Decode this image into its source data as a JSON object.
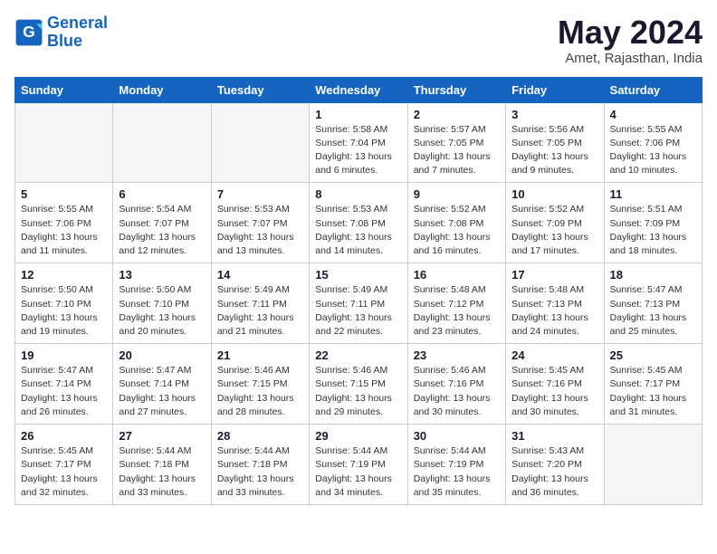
{
  "logo": {
    "line1": "General",
    "line2": "Blue"
  },
  "title": "May 2024",
  "location": "Amet, Rajasthan, India",
  "days_of_week": [
    "Sunday",
    "Monday",
    "Tuesday",
    "Wednesday",
    "Thursday",
    "Friday",
    "Saturday"
  ],
  "weeks": [
    [
      {
        "num": "",
        "info": "",
        "empty": true
      },
      {
        "num": "",
        "info": "",
        "empty": true
      },
      {
        "num": "",
        "info": "",
        "empty": true
      },
      {
        "num": "1",
        "info": "Sunrise: 5:58 AM\nSunset: 7:04 PM\nDaylight: 13 hours\nand 6 minutes."
      },
      {
        "num": "2",
        "info": "Sunrise: 5:57 AM\nSunset: 7:05 PM\nDaylight: 13 hours\nand 7 minutes."
      },
      {
        "num": "3",
        "info": "Sunrise: 5:56 AM\nSunset: 7:05 PM\nDaylight: 13 hours\nand 9 minutes."
      },
      {
        "num": "4",
        "info": "Sunrise: 5:55 AM\nSunset: 7:06 PM\nDaylight: 13 hours\nand 10 minutes."
      }
    ],
    [
      {
        "num": "5",
        "info": "Sunrise: 5:55 AM\nSunset: 7:06 PM\nDaylight: 13 hours\nand 11 minutes."
      },
      {
        "num": "6",
        "info": "Sunrise: 5:54 AM\nSunset: 7:07 PM\nDaylight: 13 hours\nand 12 minutes."
      },
      {
        "num": "7",
        "info": "Sunrise: 5:53 AM\nSunset: 7:07 PM\nDaylight: 13 hours\nand 13 minutes."
      },
      {
        "num": "8",
        "info": "Sunrise: 5:53 AM\nSunset: 7:08 PM\nDaylight: 13 hours\nand 14 minutes."
      },
      {
        "num": "9",
        "info": "Sunrise: 5:52 AM\nSunset: 7:08 PM\nDaylight: 13 hours\nand 16 minutes."
      },
      {
        "num": "10",
        "info": "Sunrise: 5:52 AM\nSunset: 7:09 PM\nDaylight: 13 hours\nand 17 minutes."
      },
      {
        "num": "11",
        "info": "Sunrise: 5:51 AM\nSunset: 7:09 PM\nDaylight: 13 hours\nand 18 minutes."
      }
    ],
    [
      {
        "num": "12",
        "info": "Sunrise: 5:50 AM\nSunset: 7:10 PM\nDaylight: 13 hours\nand 19 minutes."
      },
      {
        "num": "13",
        "info": "Sunrise: 5:50 AM\nSunset: 7:10 PM\nDaylight: 13 hours\nand 20 minutes."
      },
      {
        "num": "14",
        "info": "Sunrise: 5:49 AM\nSunset: 7:11 PM\nDaylight: 13 hours\nand 21 minutes."
      },
      {
        "num": "15",
        "info": "Sunrise: 5:49 AM\nSunset: 7:11 PM\nDaylight: 13 hours\nand 22 minutes."
      },
      {
        "num": "16",
        "info": "Sunrise: 5:48 AM\nSunset: 7:12 PM\nDaylight: 13 hours\nand 23 minutes."
      },
      {
        "num": "17",
        "info": "Sunrise: 5:48 AM\nSunset: 7:13 PM\nDaylight: 13 hours\nand 24 minutes."
      },
      {
        "num": "18",
        "info": "Sunrise: 5:47 AM\nSunset: 7:13 PM\nDaylight: 13 hours\nand 25 minutes."
      }
    ],
    [
      {
        "num": "19",
        "info": "Sunrise: 5:47 AM\nSunset: 7:14 PM\nDaylight: 13 hours\nand 26 minutes."
      },
      {
        "num": "20",
        "info": "Sunrise: 5:47 AM\nSunset: 7:14 PM\nDaylight: 13 hours\nand 27 minutes."
      },
      {
        "num": "21",
        "info": "Sunrise: 5:46 AM\nSunset: 7:15 PM\nDaylight: 13 hours\nand 28 minutes."
      },
      {
        "num": "22",
        "info": "Sunrise: 5:46 AM\nSunset: 7:15 PM\nDaylight: 13 hours\nand 29 minutes."
      },
      {
        "num": "23",
        "info": "Sunrise: 5:46 AM\nSunset: 7:16 PM\nDaylight: 13 hours\nand 30 minutes."
      },
      {
        "num": "24",
        "info": "Sunrise: 5:45 AM\nSunset: 7:16 PM\nDaylight: 13 hours\nand 30 minutes."
      },
      {
        "num": "25",
        "info": "Sunrise: 5:45 AM\nSunset: 7:17 PM\nDaylight: 13 hours\nand 31 minutes."
      }
    ],
    [
      {
        "num": "26",
        "info": "Sunrise: 5:45 AM\nSunset: 7:17 PM\nDaylight: 13 hours\nand 32 minutes."
      },
      {
        "num": "27",
        "info": "Sunrise: 5:44 AM\nSunset: 7:18 PM\nDaylight: 13 hours\nand 33 minutes."
      },
      {
        "num": "28",
        "info": "Sunrise: 5:44 AM\nSunset: 7:18 PM\nDaylight: 13 hours\nand 33 minutes."
      },
      {
        "num": "29",
        "info": "Sunrise: 5:44 AM\nSunset: 7:19 PM\nDaylight: 13 hours\nand 34 minutes."
      },
      {
        "num": "30",
        "info": "Sunrise: 5:44 AM\nSunset: 7:19 PM\nDaylight: 13 hours\nand 35 minutes."
      },
      {
        "num": "31",
        "info": "Sunrise: 5:43 AM\nSunset: 7:20 PM\nDaylight: 13 hours\nand 36 minutes."
      },
      {
        "num": "",
        "info": "",
        "empty": true
      }
    ]
  ]
}
